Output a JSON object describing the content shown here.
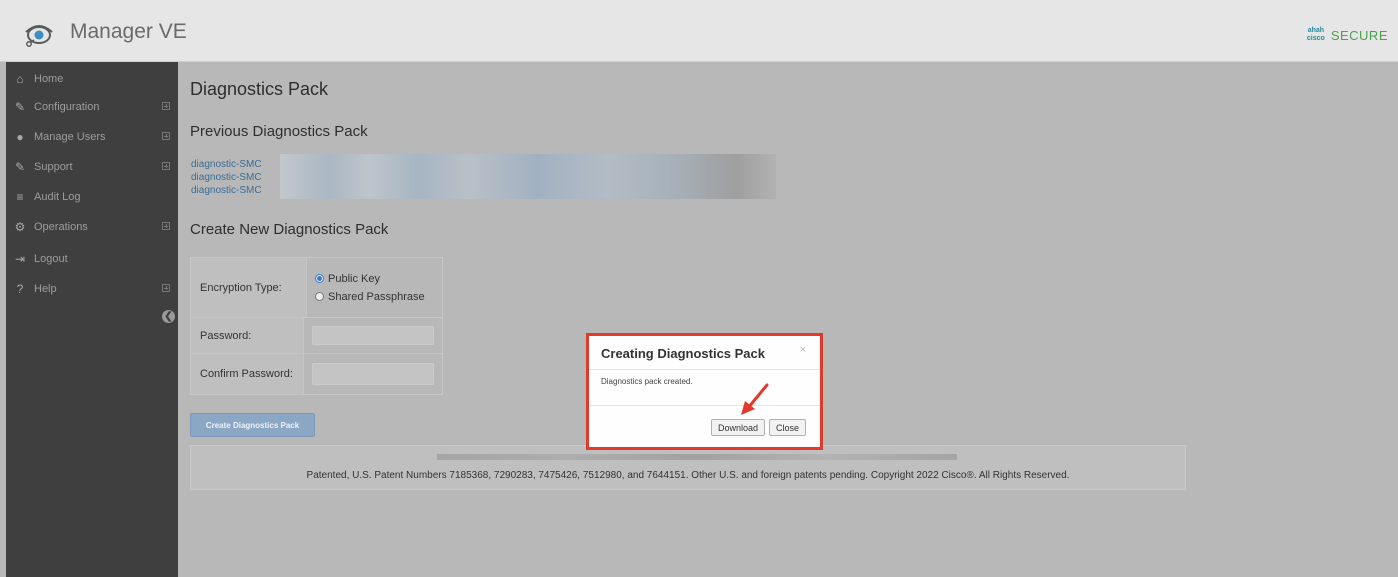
{
  "header": {
    "app_title": "Manager VE",
    "brand_cisco_top": "ahah",
    "brand_cisco_bottom": "cisco",
    "brand_secure": "SECURE"
  },
  "sidebar": {
    "items": [
      {
        "label": "Home",
        "icon": "home-icon",
        "glyph": "⌂"
      },
      {
        "label": "Configuration",
        "icon": "wrench-icon",
        "glyph": "✎"
      },
      {
        "label": "Manage Users",
        "icon": "user-icon",
        "glyph": "●"
      },
      {
        "label": "Support",
        "icon": "wrench-icon",
        "glyph": "✎"
      },
      {
        "label": "Audit Log",
        "icon": "list-icon",
        "glyph": "≡"
      },
      {
        "label": "Operations",
        "icon": "gears-icon",
        "glyph": "⚙"
      },
      {
        "label": "Logout",
        "icon": "logout-icon",
        "glyph": "⇥"
      },
      {
        "label": "Help",
        "icon": "help-icon",
        "glyph": "?"
      }
    ],
    "collapse_glyph": "❮"
  },
  "main": {
    "title": "Diagnostics Pack",
    "previous_heading": "Previous Diagnostics Pack",
    "previous_links": [
      "diagnostic-SMC",
      "diagnostic-SMC",
      "diagnostic-SMC"
    ],
    "create_heading": "Create New Diagnostics Pack",
    "form": {
      "encryption_label": "Encryption Type:",
      "option_public": "Public Key",
      "option_shared": "Shared Passphrase",
      "selected_option": "Public Key",
      "password_label": "Password:",
      "password_value": "",
      "confirm_label": "Confirm Password:",
      "confirm_value": ""
    },
    "create_button": "Create Diagnostics Pack",
    "footer_text": "Patented, U.S. Patent Numbers 7185368, 7290283, 7475426, 7512980, and 7644151. Other U.S. and foreign patents pending. Copyright 2022 Cisco®. All Rights Reserved."
  },
  "modal": {
    "title": "Creating Diagnostics Pack",
    "close_glyph": "×",
    "message": "Diagnostics pack created.",
    "download_label": "Download",
    "close_label": "Close",
    "highlight_color": "#e1392b"
  },
  "colors": {
    "sidebar_bg": "#3f3f3f",
    "page_bg": "#b8b8b8",
    "link": "#3a6d98",
    "primary_button": "#8ba7c6"
  }
}
